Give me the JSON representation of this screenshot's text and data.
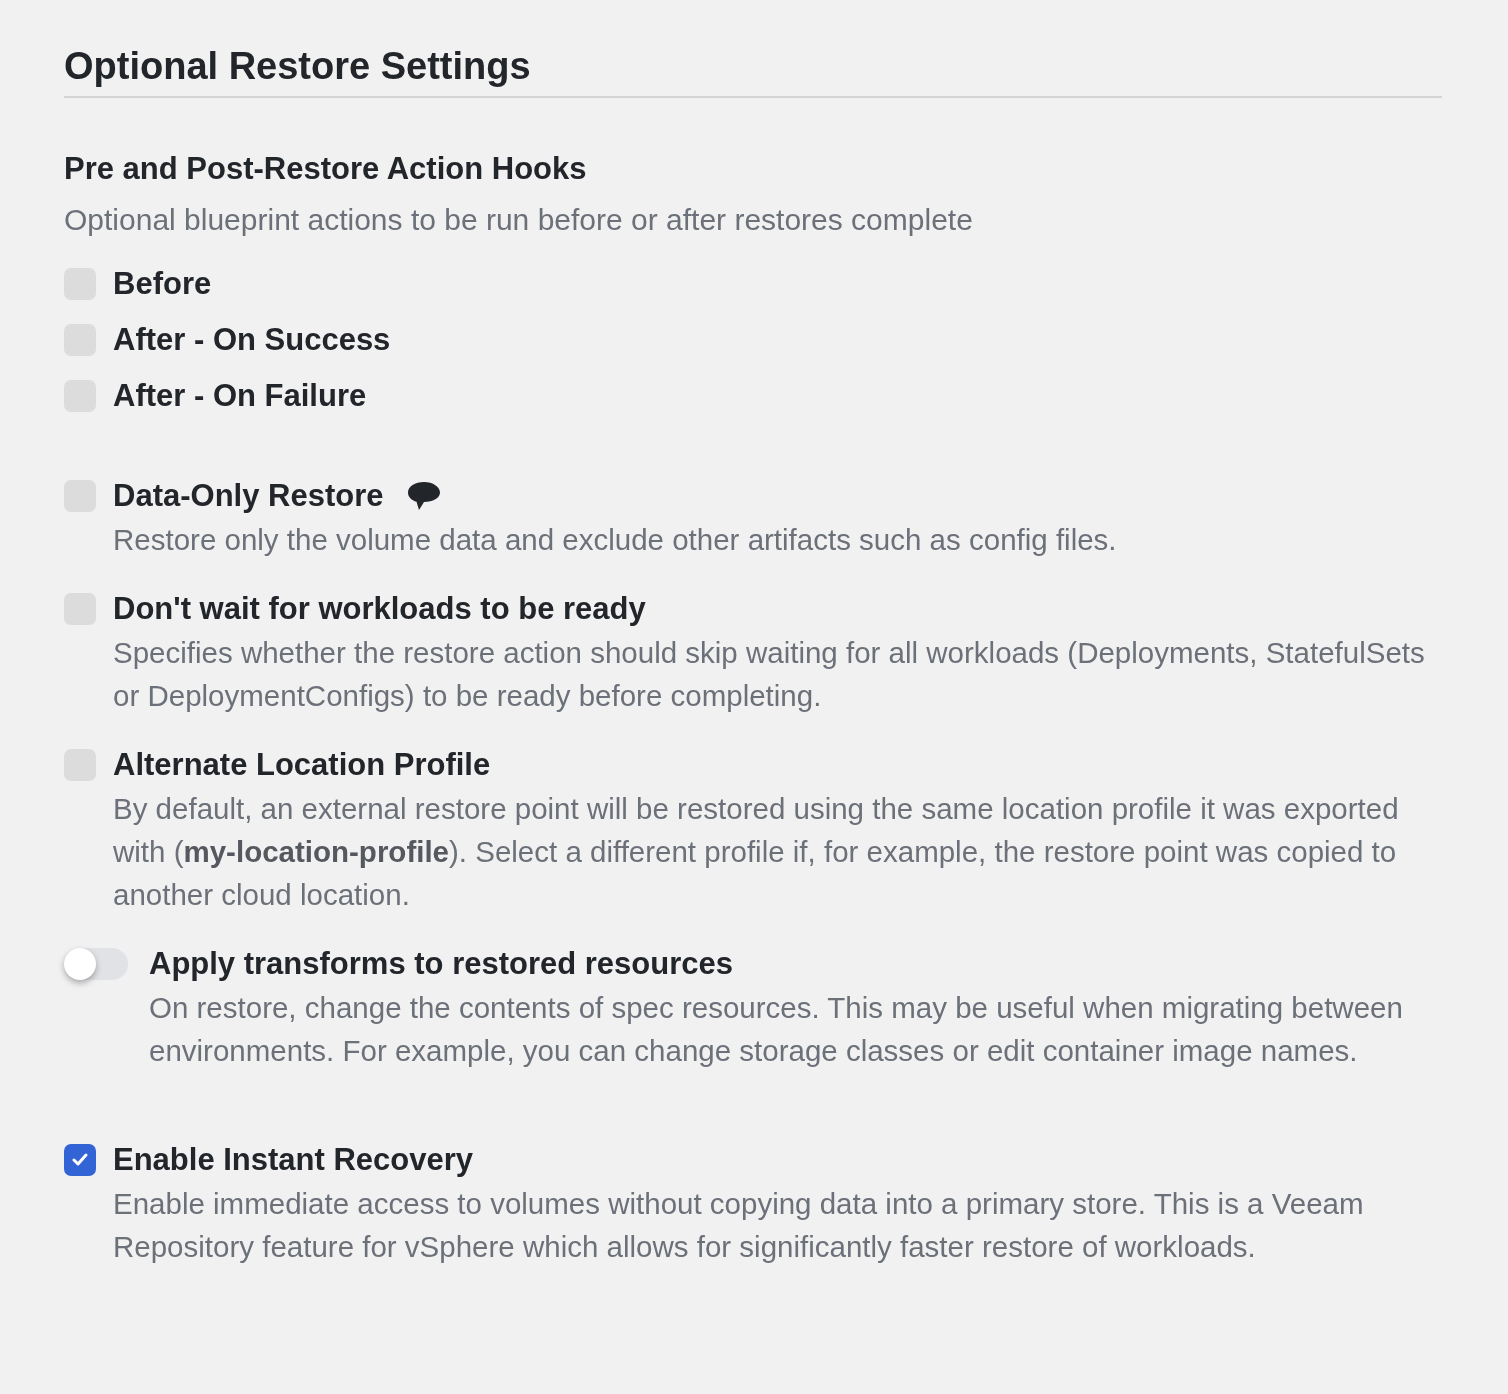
{
  "title": "Optional Restore Settings",
  "hooks": {
    "heading": "Pre and Post-Restore Action Hooks",
    "description": "Optional blueprint actions to be run before or after restores complete",
    "items": [
      {
        "label": "Before",
        "checked": false
      },
      {
        "label": "After - On Success",
        "checked": false
      },
      {
        "label": "After - On Failure",
        "checked": false
      }
    ]
  },
  "options": [
    {
      "kind": "checkbox",
      "label": "Data-Only Restore",
      "checked": false,
      "help_icon": true,
      "description": "Restore only the volume data and exclude other artifacts such as config files."
    },
    {
      "kind": "checkbox",
      "label": "Don't wait for workloads to be ready",
      "checked": false,
      "description": "Specifies whether the restore action should skip waiting for all workloads (Deployments, StatefulSets or DeploymentConfigs) to be ready before completing."
    },
    {
      "kind": "checkbox",
      "label": "Alternate Location Profile",
      "checked": false,
      "description": "By default, an external restore point will be restored using the same location profile it was exported with (**my-location-profile**). Select a different profile if, for example, the restore point was copied to another cloud location."
    },
    {
      "kind": "toggle",
      "label": "Apply transforms to restored resources",
      "on": false,
      "description": "On restore, change the contents of spec resources. This may be useful when migrating between environments. For example, you can change storage classes or edit container image names."
    },
    {
      "kind": "checkbox",
      "label": "Enable Instant Recovery",
      "checked": true,
      "description": "Enable immediate access to volumes without copying data into a primary store. This is a Veeam Repository feature for vSphere which allows for significantly faster restore of workloads."
    }
  ]
}
